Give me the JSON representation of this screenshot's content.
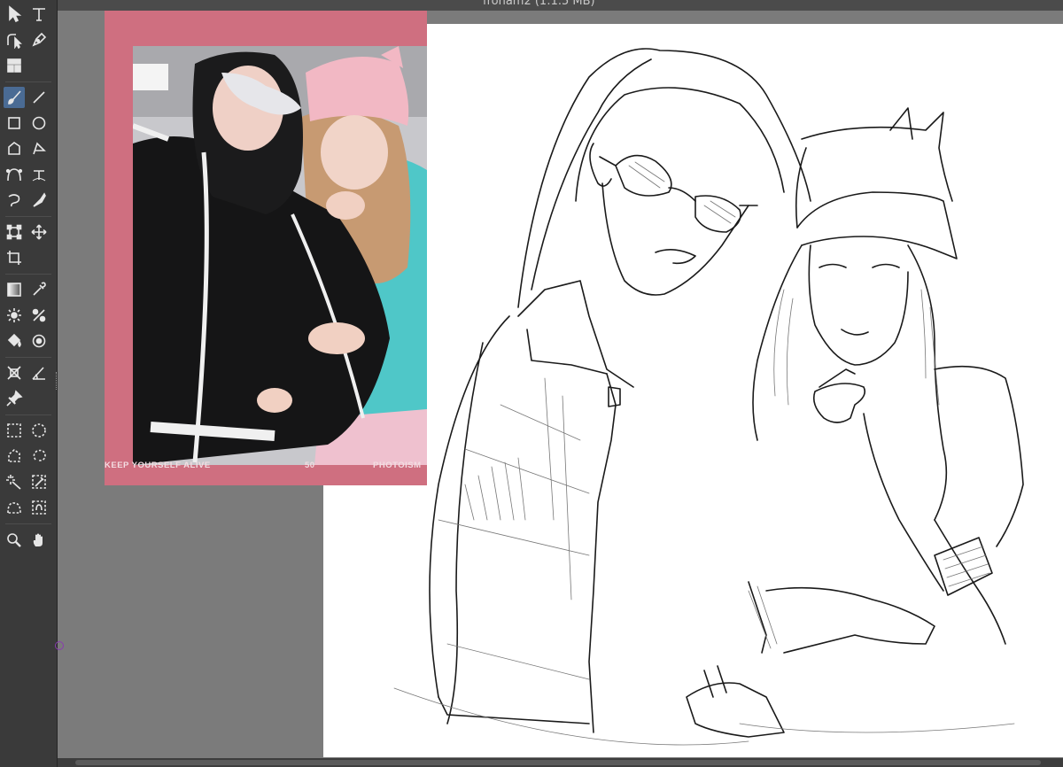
{
  "window": {
    "title": "froham2 (1:1.5 MB)"
  },
  "toolbar": {
    "tools": [
      {
        "name": "move-tool",
        "icon": "arrow-icon"
      },
      {
        "name": "type-tool",
        "icon": "text-icon"
      },
      {
        "name": "path-select-tool",
        "icon": "path-select-icon"
      },
      {
        "name": "pen-tool",
        "icon": "pen-nib-icon"
      },
      {
        "name": "layout-tool",
        "icon": "layout-icon"
      },
      {
        "name": "brush-tool",
        "icon": "brush-icon",
        "active": true
      },
      {
        "name": "line-tool",
        "icon": "line-icon"
      },
      {
        "name": "rectangle-tool",
        "icon": "square-icon"
      },
      {
        "name": "ellipse-tool",
        "icon": "circle-icon"
      },
      {
        "name": "polygon-tool",
        "icon": "polygon-icon"
      },
      {
        "name": "freehand-tool",
        "icon": "freehand-icon"
      },
      {
        "name": "bezier-tool",
        "icon": "bezier-icon"
      },
      {
        "name": "text-on-path-tool",
        "icon": "text-path-icon"
      },
      {
        "name": "spiral-tool",
        "icon": "spiral-icon"
      },
      {
        "name": "calligraphy-tool",
        "icon": "calligraphy-icon"
      },
      {
        "name": "transform-tool",
        "icon": "transform-icon"
      },
      {
        "name": "move-canvas-tool",
        "icon": "move-arrows-icon"
      },
      {
        "name": "crop-tool",
        "icon": "crop-icon"
      },
      {
        "name": "gradient-tool",
        "icon": "gradient-icon"
      },
      {
        "name": "eyedropper-tool",
        "icon": "eyedropper-icon"
      },
      {
        "name": "smudge-tool",
        "icon": "smudge-icon"
      },
      {
        "name": "color-picker-tool",
        "icon": "color-picker-icon"
      },
      {
        "name": "fill-tool",
        "icon": "bucket-icon"
      },
      {
        "name": "smart-patch-tool",
        "icon": "patch-icon"
      },
      {
        "name": "assistant-tool",
        "icon": "assistant-icon"
      },
      {
        "name": "measure-tool",
        "icon": "measure-icon"
      },
      {
        "name": "reference-tool",
        "icon": "pin-icon"
      },
      {
        "name": "rect-select-tool",
        "icon": "rect-select-icon"
      },
      {
        "name": "ellipse-select-tool",
        "icon": "ellipse-select-icon"
      },
      {
        "name": "polygon-select-tool",
        "icon": "polygon-select-icon"
      },
      {
        "name": "freehand-select-tool",
        "icon": "lasso-icon"
      },
      {
        "name": "magic-wand-tool",
        "icon": "magic-wand-icon"
      },
      {
        "name": "similar-color-select-tool",
        "icon": "similar-select-icon"
      },
      {
        "name": "bezier-select-tool",
        "icon": "bezier-select-icon"
      },
      {
        "name": "magnetic-select-tool",
        "icon": "magnetic-select-icon"
      },
      {
        "name": "zoom-tool",
        "icon": "magnifier-icon"
      },
      {
        "name": "pan-tool",
        "icon": "hand-icon"
      }
    ]
  },
  "reference": {
    "caption_left": "KEEP YOURSELF ALIVE",
    "caption_center": "50",
    "caption_right": "PHOTOISM",
    "frame_color": "#cf6f80"
  },
  "canvas": {
    "background": "#ffffff"
  }
}
